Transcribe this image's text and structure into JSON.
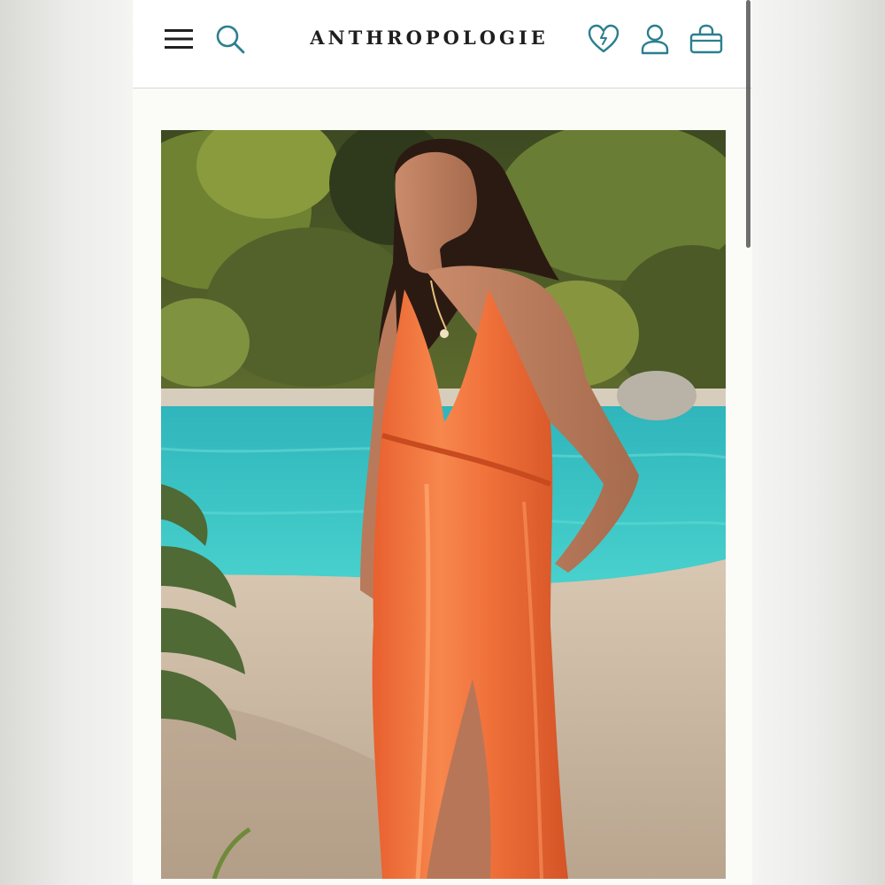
{
  "header": {
    "brand": "ANTHROPOLOGIE",
    "menu_icon": "hamburger-menu-icon",
    "search_icon": "search-icon",
    "wishlist_icon": "heart-icon",
    "account_icon": "user-icon",
    "bag_icon": "shopping-bag-icon"
  },
  "colors": {
    "icon_teal": "#2b7f8e",
    "brand_text": "#1f1f1f",
    "dress_orange": "#f0703a",
    "pool_teal": "#37c4c4"
  },
  "hero": {
    "image": "product-photo-model-orange-satin-maxi-dress-by-pool"
  }
}
